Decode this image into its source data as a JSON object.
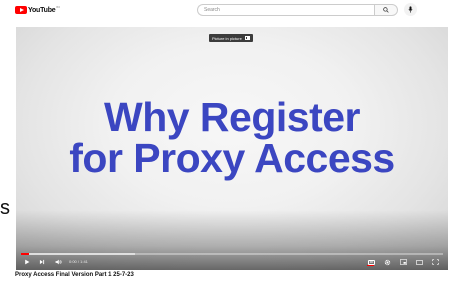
{
  "header": {
    "logo_text": "YouTube",
    "logo_sup": "IN",
    "search": {
      "placeholder": "Search",
      "value": ""
    }
  },
  "player": {
    "video_title_lines": [
      "Why Register",
      "for Proxy Access"
    ],
    "tooltip": "Picture in picture",
    "time": "0:00 / 1:41",
    "progress": {
      "played_fraction": 0.02,
      "buffered_fraction": 0.27
    },
    "colors": {
      "title": "#3b46c1",
      "progress": "#ff0000"
    }
  },
  "video": {
    "title": "Proxy Access Final Version Part 1 25-7-23"
  },
  "side_fragment": "s"
}
